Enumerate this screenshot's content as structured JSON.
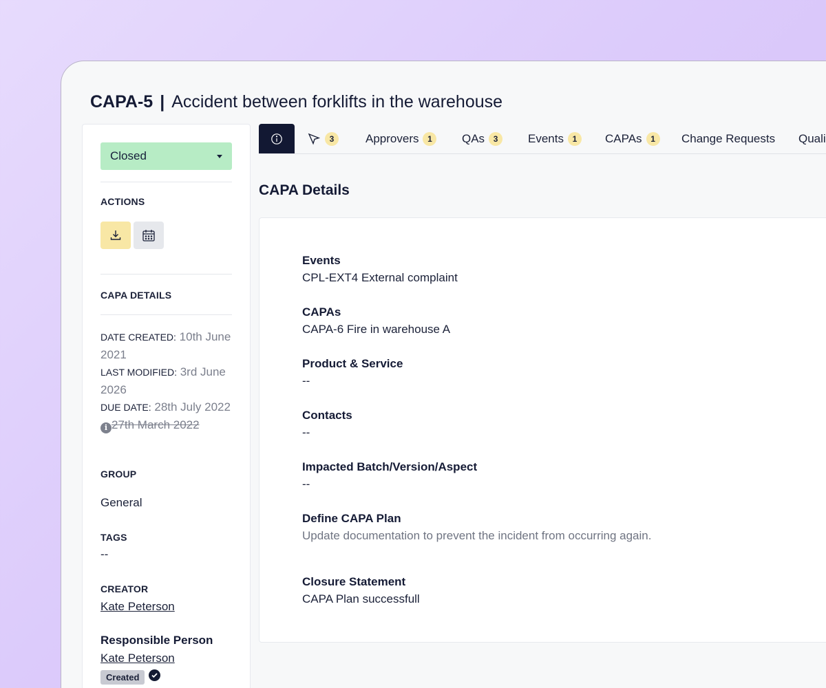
{
  "header": {
    "record_id": "CAPA-5",
    "separator": "|",
    "title": "Accident between forklifts in the warehouse"
  },
  "sidebar": {
    "status": "Closed",
    "actions_label": "ACTIONS",
    "details_label": "CAPA DETAILS",
    "date_created_label": "DATE CREATED:",
    "date_created": "10th June 2021",
    "last_modified_label": "LAST MODIFIED:",
    "last_modified": "3rd June 2026",
    "due_date_label": "DUE DATE:",
    "due_date": "28th July 2022",
    "old_due_date": "27th March 2022",
    "group_label": "GROUP",
    "group_value": "General",
    "tags_label": "TAGS",
    "tags_value": "--",
    "creator_label": "CREATOR",
    "creator": "Kate Peterson",
    "responsible_label": "Responsible Person",
    "responsible": "Kate Peterson",
    "responsible_status": "Created"
  },
  "tabs": [
    {
      "label": "",
      "icon": "info-icon",
      "active": true
    },
    {
      "label": "",
      "icon": "cursor-icon",
      "count": "3"
    },
    {
      "label": "Approvers",
      "count": "1"
    },
    {
      "label": "QAs",
      "count": "3"
    },
    {
      "label": "Events",
      "count": "1"
    },
    {
      "label": "CAPAs",
      "count": "1"
    },
    {
      "label": "Change Requests"
    },
    {
      "label": "Quali"
    }
  ],
  "main": {
    "section_title": "CAPA Details",
    "fields": [
      {
        "label": "Events",
        "value": "CPL-EXT4 External complaint"
      },
      {
        "label": "CAPAs",
        "value": "CAPA-6 Fire in warehouse A"
      },
      {
        "label": "Product & Service",
        "value": "--"
      },
      {
        "label": "Contacts",
        "value": "--"
      },
      {
        "label": "Impacted Batch/Version/Aspect",
        "value": "--"
      },
      {
        "label": "Define CAPA Plan",
        "value": "Update documentation to prevent the incident from occurring again."
      },
      {
        "label": "Closure Statement",
        "value": "CAPA Plan successfull"
      }
    ]
  },
  "colors": {
    "status_closed": "#b7ecc5",
    "count_badge": "#f8e7a5",
    "active_tab": "#121833"
  }
}
